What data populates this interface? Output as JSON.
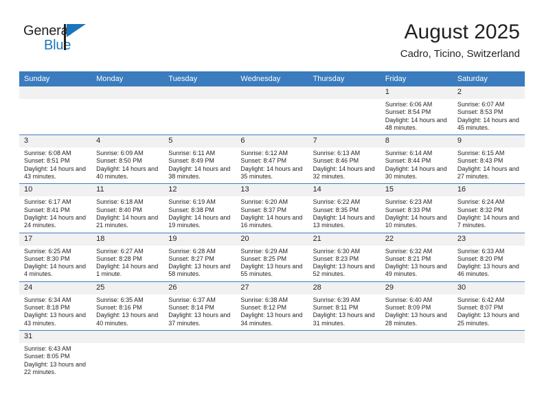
{
  "brand": {
    "name_part1": "General",
    "name_part2": "Blue"
  },
  "header": {
    "title": "August 2025",
    "subtitle": "Cadro, Ticino, Switzerland"
  },
  "weekday_headers": [
    "Sunday",
    "Monday",
    "Tuesday",
    "Wednesday",
    "Thursday",
    "Friday",
    "Saturday"
  ],
  "labels": {
    "sunrise_prefix": "Sunrise:",
    "sunset_prefix": "Sunset:",
    "daylight_prefix": "Daylight:"
  },
  "colors": {
    "header_blue": "#3a7cbe",
    "brand_blue": "#1b75bb",
    "daynum_band": "#f1f1f1",
    "text": "#231f20"
  },
  "weeks": [
    [
      {
        "empty": true
      },
      {
        "empty": true
      },
      {
        "empty": true
      },
      {
        "empty": true
      },
      {
        "empty": true
      },
      {
        "day": "1",
        "sunrise": "Sunrise: 6:06 AM",
        "sunset": "Sunset: 8:54 PM",
        "daylight": "Daylight: 14 hours and 48 minutes."
      },
      {
        "day": "2",
        "sunrise": "Sunrise: 6:07 AM",
        "sunset": "Sunset: 8:53 PM",
        "daylight": "Daylight: 14 hours and 45 minutes."
      }
    ],
    [
      {
        "day": "3",
        "sunrise": "Sunrise: 6:08 AM",
        "sunset": "Sunset: 8:51 PM",
        "daylight": "Daylight: 14 hours and 43 minutes."
      },
      {
        "day": "4",
        "sunrise": "Sunrise: 6:09 AM",
        "sunset": "Sunset: 8:50 PM",
        "daylight": "Daylight: 14 hours and 40 minutes."
      },
      {
        "day": "5",
        "sunrise": "Sunrise: 6:11 AM",
        "sunset": "Sunset: 8:49 PM",
        "daylight": "Daylight: 14 hours and 38 minutes."
      },
      {
        "day": "6",
        "sunrise": "Sunrise: 6:12 AM",
        "sunset": "Sunset: 8:47 PM",
        "daylight": "Daylight: 14 hours and 35 minutes."
      },
      {
        "day": "7",
        "sunrise": "Sunrise: 6:13 AM",
        "sunset": "Sunset: 8:46 PM",
        "daylight": "Daylight: 14 hours and 32 minutes."
      },
      {
        "day": "8",
        "sunrise": "Sunrise: 6:14 AM",
        "sunset": "Sunset: 8:44 PM",
        "daylight": "Daylight: 14 hours and 30 minutes."
      },
      {
        "day": "9",
        "sunrise": "Sunrise: 6:15 AM",
        "sunset": "Sunset: 8:43 PM",
        "daylight": "Daylight: 14 hours and 27 minutes."
      }
    ],
    [
      {
        "day": "10",
        "sunrise": "Sunrise: 6:17 AM",
        "sunset": "Sunset: 8:41 PM",
        "daylight": "Daylight: 14 hours and 24 minutes."
      },
      {
        "day": "11",
        "sunrise": "Sunrise: 6:18 AM",
        "sunset": "Sunset: 8:40 PM",
        "daylight": "Daylight: 14 hours and 21 minutes."
      },
      {
        "day": "12",
        "sunrise": "Sunrise: 6:19 AM",
        "sunset": "Sunset: 8:38 PM",
        "daylight": "Daylight: 14 hours and 19 minutes."
      },
      {
        "day": "13",
        "sunrise": "Sunrise: 6:20 AM",
        "sunset": "Sunset: 8:37 PM",
        "daylight": "Daylight: 14 hours and 16 minutes."
      },
      {
        "day": "14",
        "sunrise": "Sunrise: 6:22 AM",
        "sunset": "Sunset: 8:35 PM",
        "daylight": "Daylight: 14 hours and 13 minutes."
      },
      {
        "day": "15",
        "sunrise": "Sunrise: 6:23 AM",
        "sunset": "Sunset: 8:33 PM",
        "daylight": "Daylight: 14 hours and 10 minutes."
      },
      {
        "day": "16",
        "sunrise": "Sunrise: 6:24 AM",
        "sunset": "Sunset: 8:32 PM",
        "daylight": "Daylight: 14 hours and 7 minutes."
      }
    ],
    [
      {
        "day": "17",
        "sunrise": "Sunrise: 6:25 AM",
        "sunset": "Sunset: 8:30 PM",
        "daylight": "Daylight: 14 hours and 4 minutes."
      },
      {
        "day": "18",
        "sunrise": "Sunrise: 6:27 AM",
        "sunset": "Sunset: 8:28 PM",
        "daylight": "Daylight: 14 hours and 1 minute."
      },
      {
        "day": "19",
        "sunrise": "Sunrise: 6:28 AM",
        "sunset": "Sunset: 8:27 PM",
        "daylight": "Daylight: 13 hours and 58 minutes."
      },
      {
        "day": "20",
        "sunrise": "Sunrise: 6:29 AM",
        "sunset": "Sunset: 8:25 PM",
        "daylight": "Daylight: 13 hours and 55 minutes."
      },
      {
        "day": "21",
        "sunrise": "Sunrise: 6:30 AM",
        "sunset": "Sunset: 8:23 PM",
        "daylight": "Daylight: 13 hours and 52 minutes."
      },
      {
        "day": "22",
        "sunrise": "Sunrise: 6:32 AM",
        "sunset": "Sunset: 8:21 PM",
        "daylight": "Daylight: 13 hours and 49 minutes."
      },
      {
        "day": "23",
        "sunrise": "Sunrise: 6:33 AM",
        "sunset": "Sunset: 8:20 PM",
        "daylight": "Daylight: 13 hours and 46 minutes."
      }
    ],
    [
      {
        "day": "24",
        "sunrise": "Sunrise: 6:34 AM",
        "sunset": "Sunset: 8:18 PM",
        "daylight": "Daylight: 13 hours and 43 minutes."
      },
      {
        "day": "25",
        "sunrise": "Sunrise: 6:35 AM",
        "sunset": "Sunset: 8:16 PM",
        "daylight": "Daylight: 13 hours and 40 minutes."
      },
      {
        "day": "26",
        "sunrise": "Sunrise: 6:37 AM",
        "sunset": "Sunset: 8:14 PM",
        "daylight": "Daylight: 13 hours and 37 minutes."
      },
      {
        "day": "27",
        "sunrise": "Sunrise: 6:38 AM",
        "sunset": "Sunset: 8:12 PM",
        "daylight": "Daylight: 13 hours and 34 minutes."
      },
      {
        "day": "28",
        "sunrise": "Sunrise: 6:39 AM",
        "sunset": "Sunset: 8:11 PM",
        "daylight": "Daylight: 13 hours and 31 minutes."
      },
      {
        "day": "29",
        "sunrise": "Sunrise: 6:40 AM",
        "sunset": "Sunset: 8:09 PM",
        "daylight": "Daylight: 13 hours and 28 minutes."
      },
      {
        "day": "30",
        "sunrise": "Sunrise: 6:42 AM",
        "sunset": "Sunset: 8:07 PM",
        "daylight": "Daylight: 13 hours and 25 minutes."
      }
    ],
    [
      {
        "day": "31",
        "sunrise": "Sunrise: 6:43 AM",
        "sunset": "Sunset: 8:05 PM",
        "daylight": "Daylight: 13 hours and 22 minutes."
      },
      {
        "empty": true
      },
      {
        "empty": true
      },
      {
        "empty": true
      },
      {
        "empty": true
      },
      {
        "empty": true
      },
      {
        "empty": true
      }
    ]
  ]
}
